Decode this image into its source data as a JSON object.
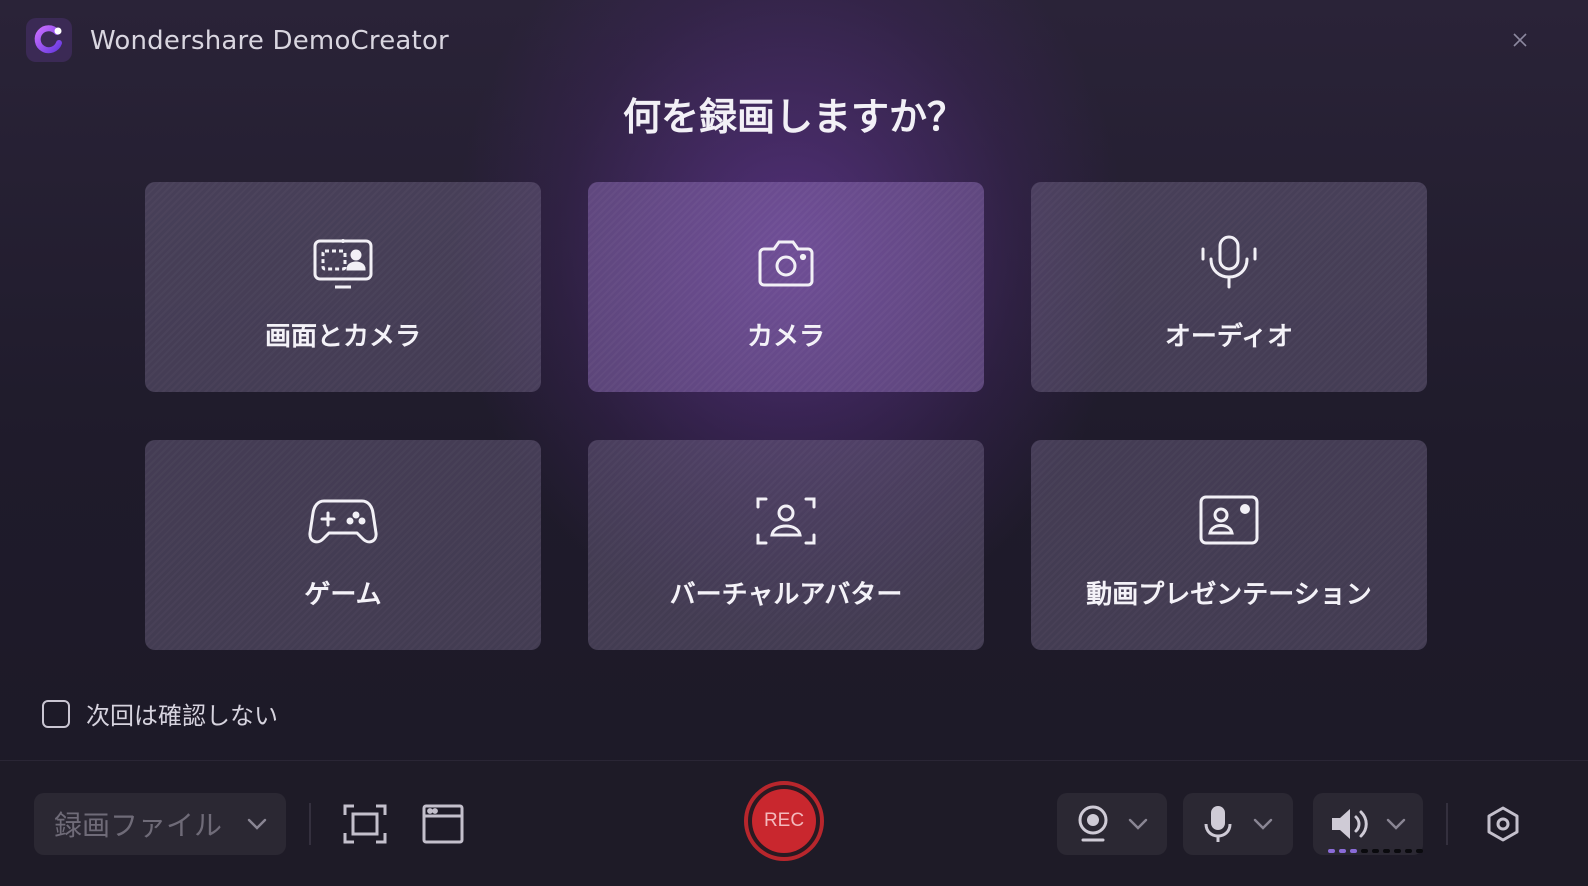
{
  "app": {
    "title": "Wondershare DemoCreator",
    "logo_icon": "democreator-logo-icon",
    "accent_color": "#7a3fd0"
  },
  "heading": "何を録画しますか？",
  "cards": [
    {
      "label": "画面とカメラ",
      "icon": "screen-camera-icon"
    },
    {
      "label": "カメラ",
      "icon": "camera-icon"
    },
    {
      "label": "オーディオ",
      "icon": "microphone-icon"
    },
    {
      "label": "ゲーム",
      "icon": "gamepad-icon"
    },
    {
      "label": "バーチャルアバター",
      "icon": "avatar-frame-icon"
    },
    {
      "label": "動画プレゼンテーション",
      "icon": "presentation-icon"
    }
  ],
  "dont_ask_again": {
    "label": "次回は確認しない",
    "checked": false
  },
  "toolbar": {
    "file_select_value": "録画ファイル",
    "rec_label": "REC",
    "rec_color": "#c9272e",
    "icons": [
      "region-capture-icon",
      "window-capture-icon",
      "webcam-icon",
      "microphone-icon",
      "speaker-icon",
      "settings-icon"
    ],
    "volume_level_color_active": "#8a6bd8",
    "volume_level_color_inactive": "#000000"
  }
}
